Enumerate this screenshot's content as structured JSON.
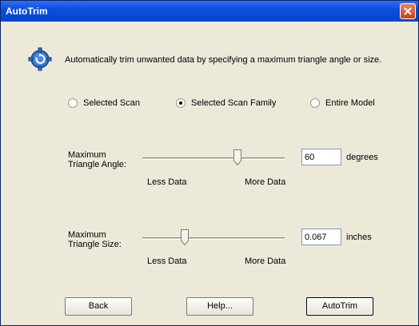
{
  "window": {
    "title": "AutoTrim"
  },
  "description": "Automatically trim unwanted data by specifying a maximum triangle angle or size.",
  "scope_options": [
    {
      "label": "Selected Scan",
      "selected": false
    },
    {
      "label": "Selected Scan Family",
      "selected": true
    },
    {
      "label": "Entire Model",
      "selected": false
    }
  ],
  "angle": {
    "label_line1": "Maximum",
    "label_line2": "Triangle Angle:",
    "value": "60",
    "unit": "degrees",
    "left_label": "Less Data",
    "right_label": "More Data",
    "slider_fraction": 0.67
  },
  "size": {
    "label_line1": "Maximum",
    "label_line2": "Triangle Size:",
    "value": "0.067",
    "unit": "inches",
    "left_label": "Less Data",
    "right_label": "More Data",
    "slider_fraction": 0.3
  },
  "buttons": {
    "back": "Back",
    "help": "Help...",
    "autotrim": "AutoTrim"
  },
  "colors": {
    "title_bar": "#0a4fe0",
    "dialog_bg": "#ece9d8",
    "close_button": "#d2502b"
  },
  "icons": {
    "header_icon": "gear-icon",
    "close": "close-icon"
  }
}
